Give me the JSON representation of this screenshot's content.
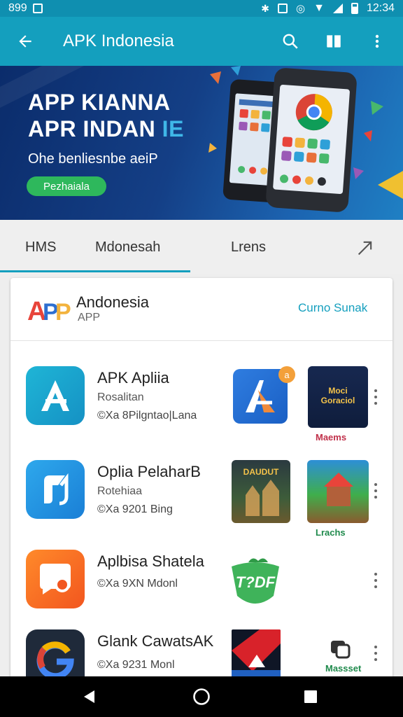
{
  "status_bar": {
    "left_text": "899",
    "time": "12:34"
  },
  "app_bar": {
    "title": "APK Indonesia"
  },
  "banner": {
    "headline_line1": "APP KIANNA",
    "headline_line2_main": "APR INDAN",
    "headline_line2_accent": " IE",
    "subtitle": "Ohe benliesnbe aeiP",
    "button_label": "Pezhaiala"
  },
  "tabs": [
    {
      "label": "HMS"
    },
    {
      "label": "Mdonesah"
    },
    {
      "label": "Lrens"
    }
  ],
  "card": {
    "title": "Andonesia",
    "subtitle": "APP",
    "link_label": "Curno Sunak",
    "logo_text": "AP"
  },
  "apps": [
    {
      "name": "APK Apliia",
      "meta1": "Rosalitan",
      "meta2": "©Xa 8Pilgntao|Lana",
      "thumb2_label": "Maems",
      "thumb2_text": "Moci Goraciol",
      "badge": "a"
    },
    {
      "name": "Oplia PelaharB",
      "meta1": "Rotehiaa",
      "meta2": "©Xa 9201 Bing",
      "thumb1_text": "DAUDUT",
      "thumb2_label": "Lrachs"
    },
    {
      "name": "Aplbisa Shatela",
      "meta1": "",
      "meta2": "©Xa 9XN Mdonl",
      "thumb1_text": "T?DF"
    },
    {
      "name": "Glank CawatsAK",
      "meta1": "",
      "meta2": "©Xa 9231 Monl",
      "thumb2_label": "Massset"
    }
  ],
  "colors": {
    "primary": "#149fbe",
    "accent_green": "#2eb85c",
    "link": "#149fbe"
  }
}
